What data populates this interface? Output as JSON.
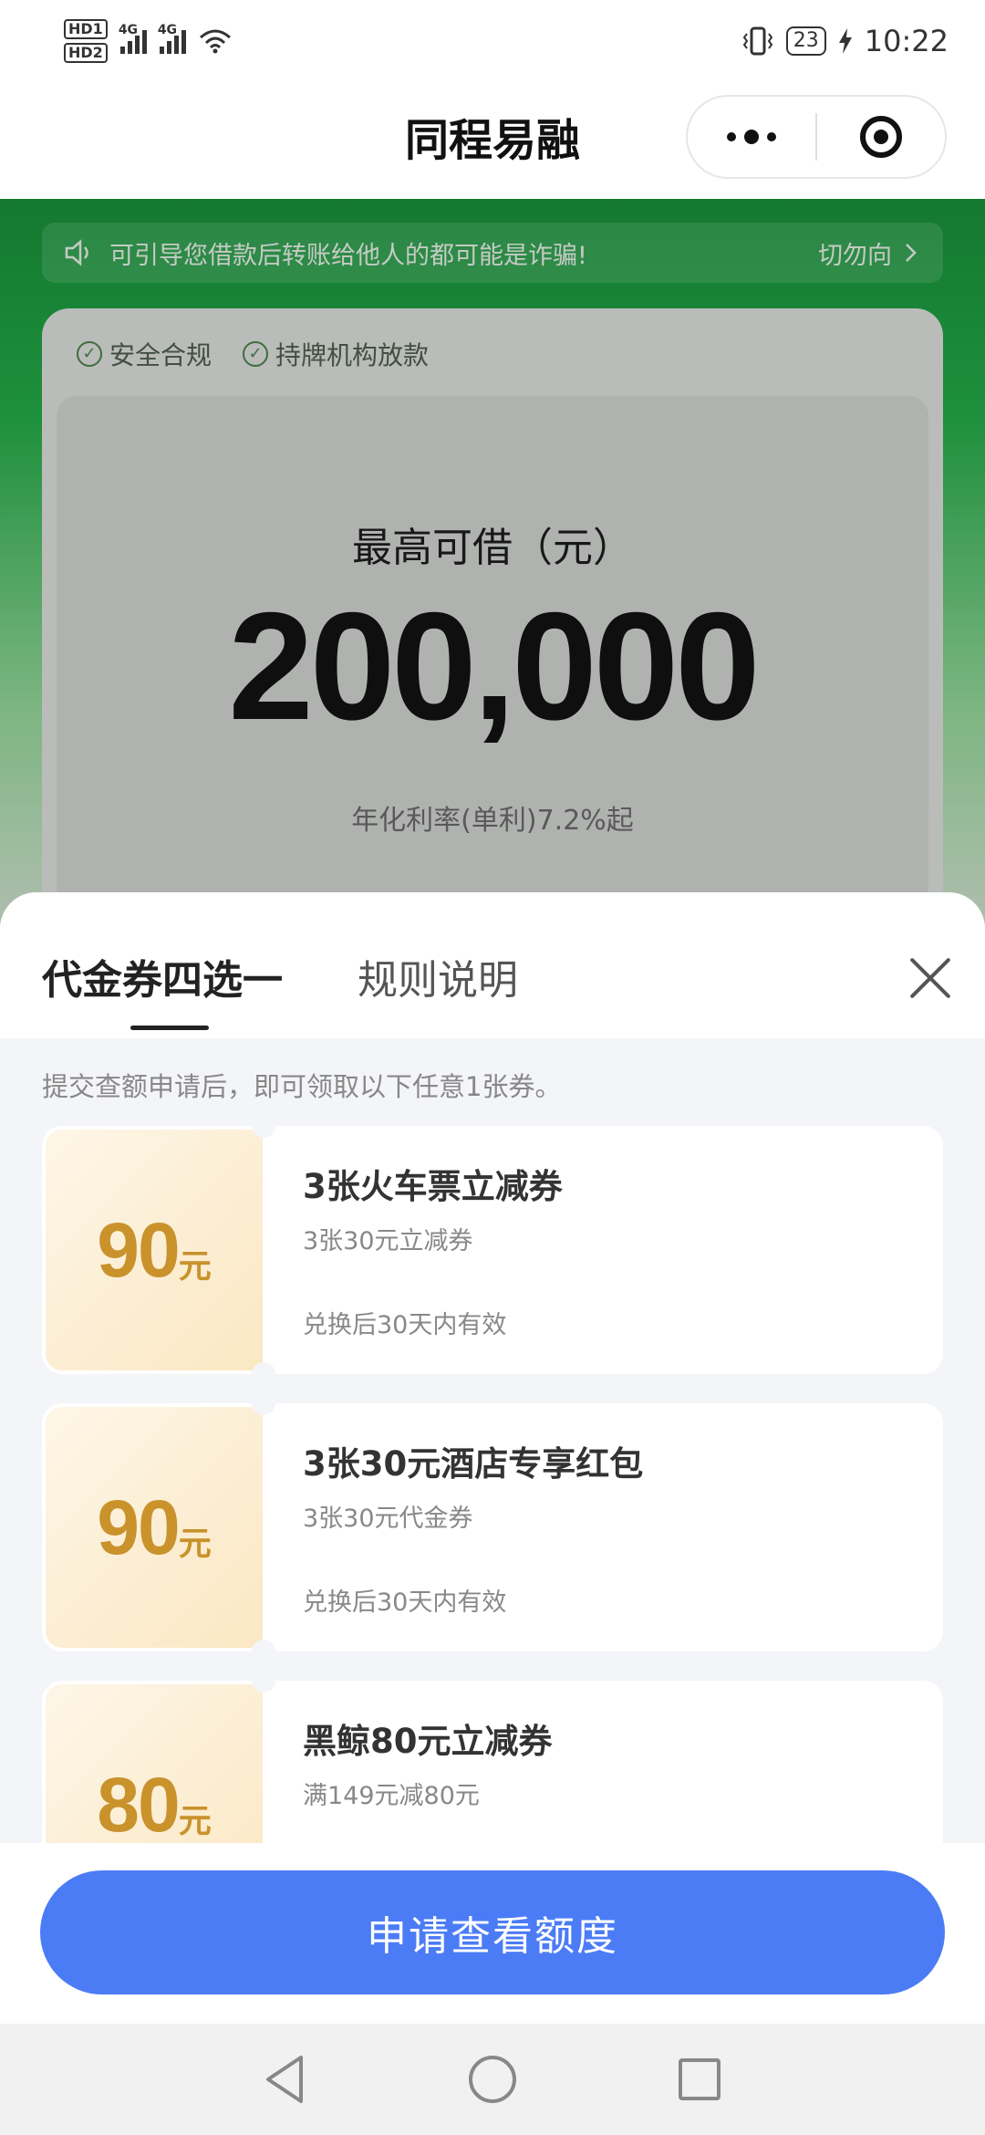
{
  "status_bar": {
    "sim1": "HD1",
    "sim2": "HD2",
    "net1": "4G",
    "net2": "4G",
    "battery": "23",
    "time": "10:22"
  },
  "title_bar": {
    "title": "同程易融",
    "more_icon": "more-dots-icon",
    "close_icon": "target-icon"
  },
  "hero": {
    "notice_text": "可引导您借款后转账给他人的都可能是诈骗!",
    "notice_right": "切勿向",
    "badges": [
      "安全合规",
      "持牌机构放款"
    ],
    "max_label": "最高可借（元）",
    "amount": "200,000",
    "rate": "年化利率(单利)7.2%起"
  },
  "sheet": {
    "tabs": [
      "代金券四选一",
      "规则说明"
    ],
    "tip": "提交查额申请后，即可领取以下任意1张券。",
    "coupons": [
      {
        "value": "90",
        "unit": "元",
        "name": "3张火车票立减券",
        "desc": "3张30元立减券",
        "valid": "兑换后30天内有效"
      },
      {
        "value": "90",
        "unit": "元",
        "name": "3张30元酒店专享红包",
        "desc": "3张30元代金券",
        "valid": "兑换后30天内有效"
      },
      {
        "value": "80",
        "unit": "元",
        "name": "黑鲸80元立减券",
        "desc": "满149元减80元",
        "valid": ""
      }
    ]
  },
  "action": {
    "apply_label": "申请查看额度",
    "accent": "#4b7cf6"
  }
}
